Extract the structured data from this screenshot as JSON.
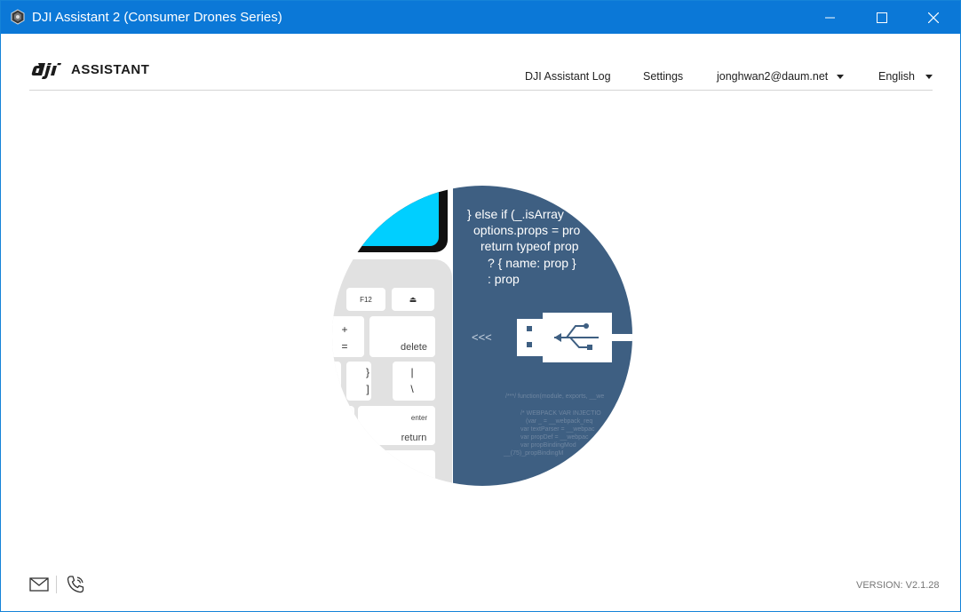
{
  "window": {
    "title": "DJI Assistant 2 (Consumer Drones Series)",
    "controls": [
      "minimize-icon",
      "maximize-icon",
      "close-icon"
    ]
  },
  "header": {
    "logo_text": "ASSISTANT",
    "nav": {
      "log_label": "DJI Assistant Log",
      "settings_label": "Settings",
      "user_label": "jonghwan2@daum.net",
      "language_label": "English"
    }
  },
  "illustration": {
    "code_lines": [
      "} else if (_.isArray",
      "options.props = pro",
      "return typeof prop",
      "? { name: prop }",
      ": prop"
    ],
    "small_code_lines": [
      "/***/ function(module, exports, __we",
      "/* WEBPACK VAR INJECTIO",
      "(var _ = __webpack_req",
      "var textParser = __webpac",
      "var propDef = __webpac",
      "var propBindingMod",
      "__(75)_propBindingM"
    ],
    "key_labels": {
      "f12": "F12",
      "eject": "⏏",
      "plus": "+",
      "equals": "=",
      "delete": "delete",
      "brace": "}",
      "bracket": "]",
      "pipe": "|",
      "backslash": "\\",
      "enter": "enter",
      "return": "return"
    },
    "arrows": "<<<",
    "colors": {
      "panel": "#3e5f82",
      "screen": "#00cfff",
      "keyboard": "#e1e1e1"
    }
  },
  "footer": {
    "icons": [
      "mail-icon",
      "phone-icon"
    ],
    "version": "VERSION: V2.1.28"
  }
}
